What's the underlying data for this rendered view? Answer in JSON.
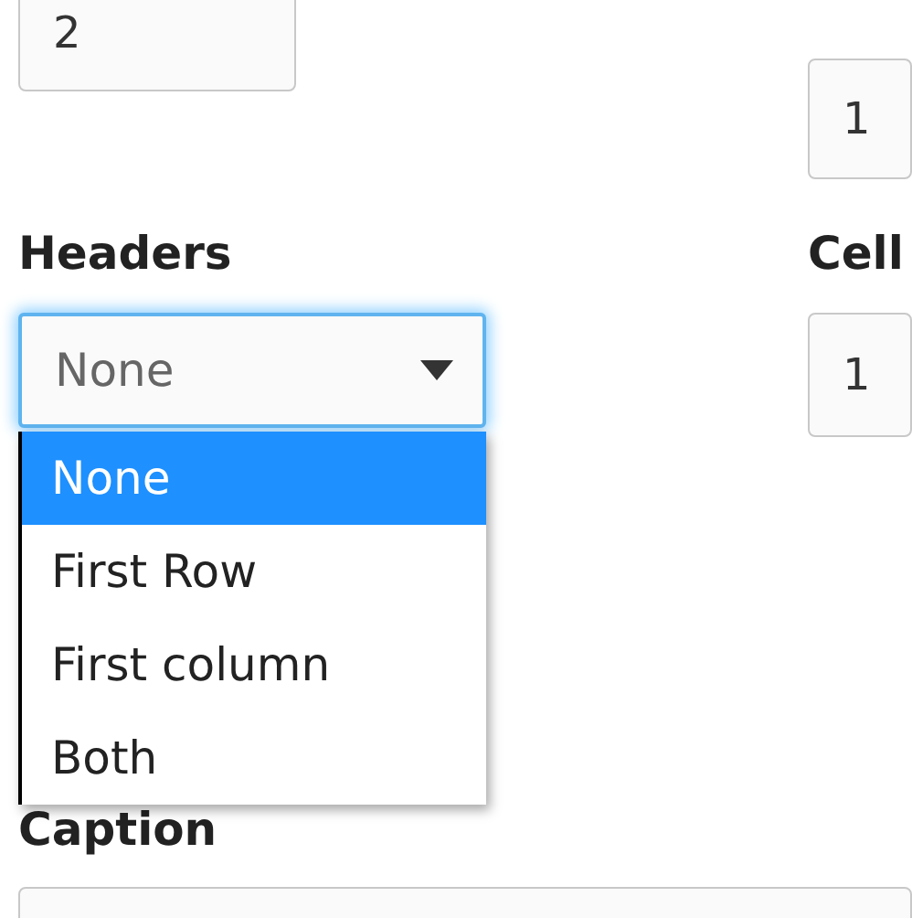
{
  "top_left_field": {
    "value": "2"
  },
  "top_right_field": {
    "value": "1"
  },
  "headers": {
    "label": "Headers",
    "value": "None",
    "expanded": true,
    "options": [
      {
        "label": "None",
        "selected": true
      },
      {
        "label": "First Row",
        "selected": false
      },
      {
        "label": "First column",
        "selected": false
      },
      {
        "label": "Both",
        "selected": false
      }
    ]
  },
  "cell_field": {
    "label": "Cell",
    "value": "1"
  },
  "caption": {
    "label": "Caption"
  }
}
